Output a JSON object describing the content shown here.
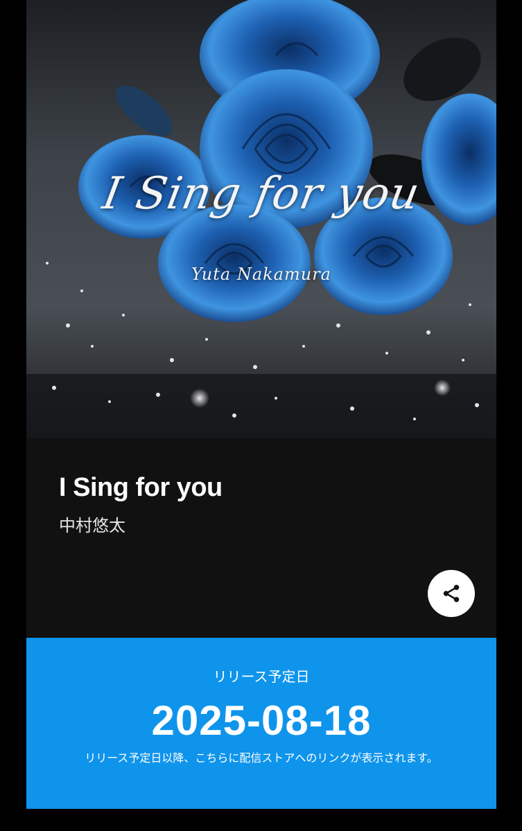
{
  "cover": {
    "title_text": "I Sing for you",
    "artist_text": "Yuta Nakamura",
    "rose_color": "#2a7fd4"
  },
  "track": {
    "title": "I Sing for you",
    "artist": "中村悠太"
  },
  "share": {
    "icon": "share-icon"
  },
  "release": {
    "label": "リリース予定日",
    "date": "2025-08-18",
    "note": "リリース予定日以降、こちらに配信ストアへのリンクが表示されます。",
    "background": "#0f94ec"
  }
}
